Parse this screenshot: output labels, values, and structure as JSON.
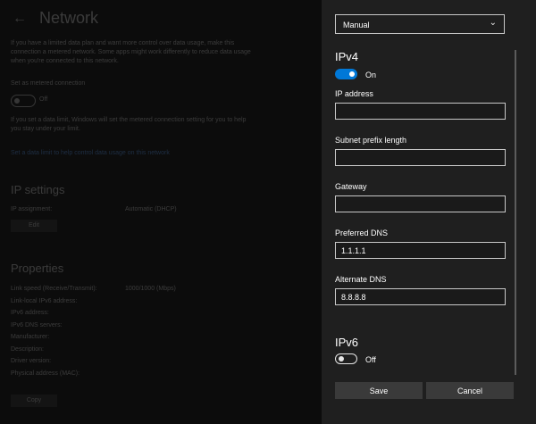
{
  "background": {
    "back_icon": "back-arrow-icon",
    "title": "Network",
    "para1": "If you have a limited data plan and want more control over data usage, make this connection a metered network. Some apps might work differently to reduce data usage when you're connected to this network.",
    "metered_label": "Set as metered connection",
    "metered_state": "Off",
    "para2": "If you set a data limit, Windows will set the metered connection setting for you to help you stay under your limit.",
    "link": "Set a data limit to help control data usage on this network",
    "ip_settings_title": "IP settings",
    "ip_assignment_label": "IP assignment:",
    "ip_assignment_value": "Automatic (DHCP)",
    "edit_label": "Edit",
    "properties_title": "Properties",
    "properties": [
      {
        "label": "Link speed (Receive/Transmit):",
        "value": "1000/1000 (Mbps)"
      },
      {
        "label": "Link-local IPv6 address:",
        "value": ""
      },
      {
        "label": "IPv6 address:",
        "value": ""
      },
      {
        "label": "IPv6 DNS servers:",
        "value": ""
      },
      {
        "label": "Manufacturer:",
        "value": ""
      },
      {
        "label": "Description:",
        "value": ""
      },
      {
        "label": "Driver version:",
        "value": ""
      },
      {
        "label": "Physical address (MAC):",
        "value": ""
      }
    ],
    "copy_label": "Copy"
  },
  "panel": {
    "mode_value": "Manual",
    "mode_icon": "chevron-down-icon",
    "ipv4": {
      "title": "IPv4",
      "toggle_state": "On",
      "ip_label": "IP address",
      "ip_value": "",
      "subnet_label": "Subnet prefix length",
      "subnet_value": "",
      "gateway_label": "Gateway",
      "gateway_value": "",
      "pref_dns_label": "Preferred DNS",
      "pref_dns_value": "1.1.1.1",
      "alt_dns_label": "Alternate DNS",
      "alt_dns_value": "8.8.8.8"
    },
    "ipv6": {
      "title": "IPv6",
      "toggle_state": "Off"
    },
    "save_label": "Save",
    "cancel_label": "Cancel"
  },
  "colors": {
    "accent": "#0078d7",
    "panel_bg": "#1f1f1f",
    "button_bg": "#3a3a3a"
  }
}
